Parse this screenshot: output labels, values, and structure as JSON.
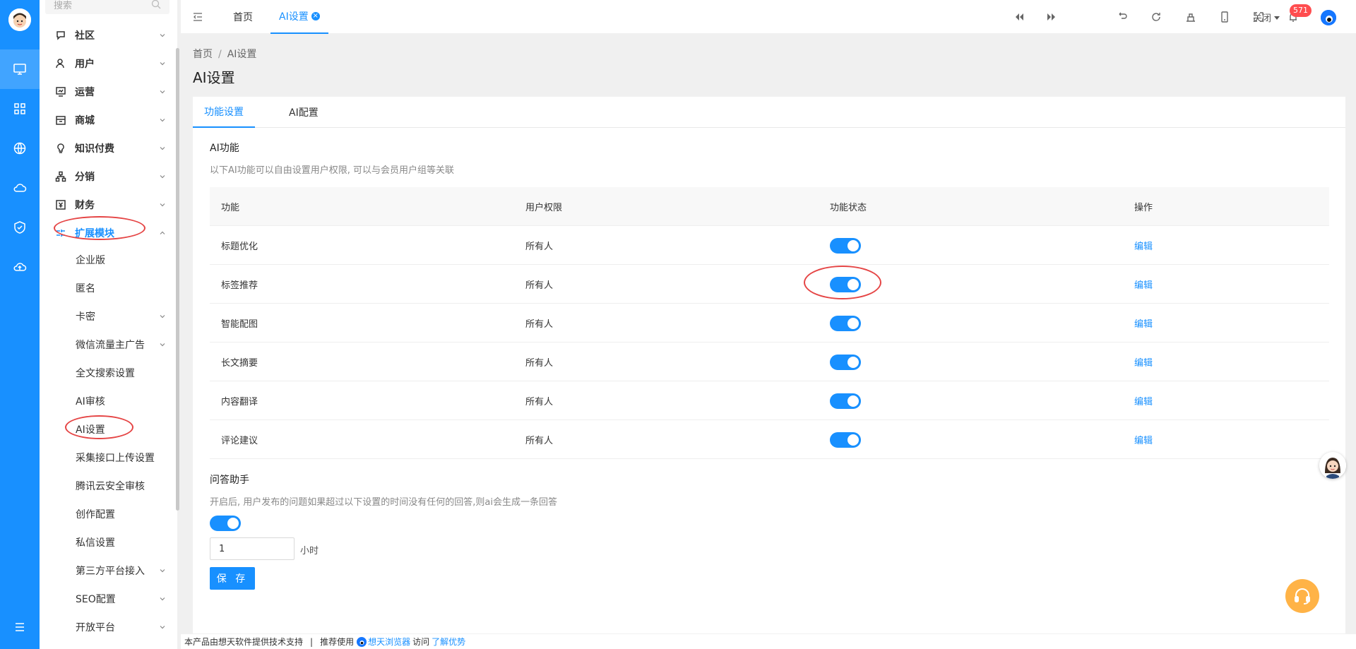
{
  "sidebar": {
    "search_placeholder": "搜索",
    "menu": [
      {
        "label": "社区",
        "icon": "chat-icon"
      },
      {
        "label": "用户",
        "icon": "user-icon"
      },
      {
        "label": "运营",
        "icon": "monitor-icon"
      },
      {
        "label": "商城",
        "icon": "shop-icon"
      },
      {
        "label": "知识付费",
        "icon": "bulb-icon"
      },
      {
        "label": "分销",
        "icon": "network-icon"
      },
      {
        "label": "财务",
        "icon": "finance-icon"
      },
      {
        "label": "扩展模块",
        "icon": "extension-icon"
      }
    ],
    "submenu": [
      {
        "label": "企业版",
        "has_chevron": false
      },
      {
        "label": "匿名",
        "has_chevron": false
      },
      {
        "label": "卡密",
        "has_chevron": true
      },
      {
        "label": "微信流量主广告",
        "has_chevron": true
      },
      {
        "label": "全文搜索设置",
        "has_chevron": false
      },
      {
        "label": "AI审核",
        "has_chevron": false
      },
      {
        "label": "AI设置",
        "has_chevron": false
      },
      {
        "label": "采集接口上传设置",
        "has_chevron": false
      },
      {
        "label": "腾讯云安全审核",
        "has_chevron": false
      },
      {
        "label": "创作配置",
        "has_chevron": false
      },
      {
        "label": "私信设置",
        "has_chevron": false
      },
      {
        "label": "第三方平台接入",
        "has_chevron": true
      },
      {
        "label": "SEO配置",
        "has_chevron": true
      },
      {
        "label": "开放平台",
        "has_chevron": true
      }
    ]
  },
  "header": {
    "tabs": [
      {
        "label": "首页"
      },
      {
        "label": "AI设置"
      }
    ],
    "close_menu": "关闭",
    "notification_count": "571"
  },
  "main": {
    "breadcrumb": [
      "首页",
      "AI设置"
    ],
    "title": "AI设置",
    "tabs": [
      {
        "label": "功能设置"
      },
      {
        "label": "AI配置"
      }
    ],
    "ai_section": {
      "title": "AI功能",
      "desc": "以下AI功能可以自由设置用户权限, 可以与会员用户组等关联"
    },
    "table": {
      "headers": [
        "功能",
        "用户权限",
        "功能状态",
        "操作"
      ],
      "rows": [
        {
          "name": "标题优化",
          "permission": "所有人",
          "enabled": true,
          "action": "编辑"
        },
        {
          "name": "标签推荐",
          "permission": "所有人",
          "enabled": true,
          "action": "编辑"
        },
        {
          "name": "智能配图",
          "permission": "所有人",
          "enabled": true,
          "action": "编辑"
        },
        {
          "name": "长文摘要",
          "permission": "所有人",
          "enabled": true,
          "action": "编辑"
        },
        {
          "name": "内容翻译",
          "permission": "所有人",
          "enabled": true,
          "action": "编辑"
        },
        {
          "name": "评论建议",
          "permission": "所有人",
          "enabled": true,
          "action": "编辑"
        }
      ]
    },
    "qa_section": {
      "title": "问答助手",
      "desc": "开启后, 用户发布的问题如果超过以下设置的时间没有任何的回答,则ai会生成一条回答",
      "enabled": true,
      "hours_value": "1",
      "unit": "小时",
      "save_label": "保 存"
    }
  },
  "footer": {
    "text": "本产品由想天软件提供技术支持",
    "pipe": "|",
    "recommend": "推荐使用",
    "browser": "想天浏览器",
    "visit": "访问",
    "advantage": "了解优势"
  },
  "colors": {
    "accent": "#1890ff",
    "rail": "#1890ff",
    "annotation": "#e54545",
    "badge": "#ff4d4f"
  }
}
